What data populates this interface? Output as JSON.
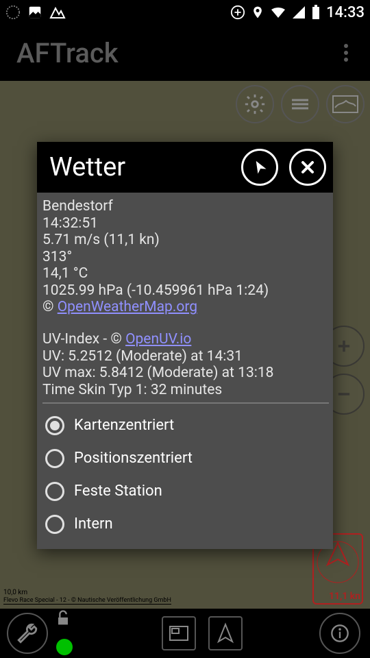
{
  "status": {
    "time": "14:33"
  },
  "app": {
    "title": "AFTrack"
  },
  "dialog": {
    "title": "Wetter",
    "location": "Bendestorf",
    "clock": "14:32:51",
    "wind": "5.71 m/s (11,1 kn)",
    "bearing": "313°",
    "temp": "14,1 °C",
    "pressure": "1025.99 hPa (-10.459961 hPa 1:24)",
    "attr1_pre": "© ",
    "attr1_link": "OpenWeatherMap.org",
    "uv_label": "UV-Index - © ",
    "uv_link": "OpenUV.io",
    "uv": "UV: 5.2512 (Moderate) at 14:31",
    "uvmax": "UV max: 5.8412 (Moderate) at 13:18",
    "skin": "Time Skin Typ 1: 32 minutes",
    "options": {
      "o1": "Kartenzentriert",
      "o2": "Positionszentriert",
      "o3": "Feste Station",
      "o4": "Intern"
    }
  },
  "map": {
    "compass_speed": "11,1 kn",
    "scale": "10,0 km",
    "attrib": "Flevo Race Special - 12 - © Nautische Veröffentlichung GmbH"
  }
}
